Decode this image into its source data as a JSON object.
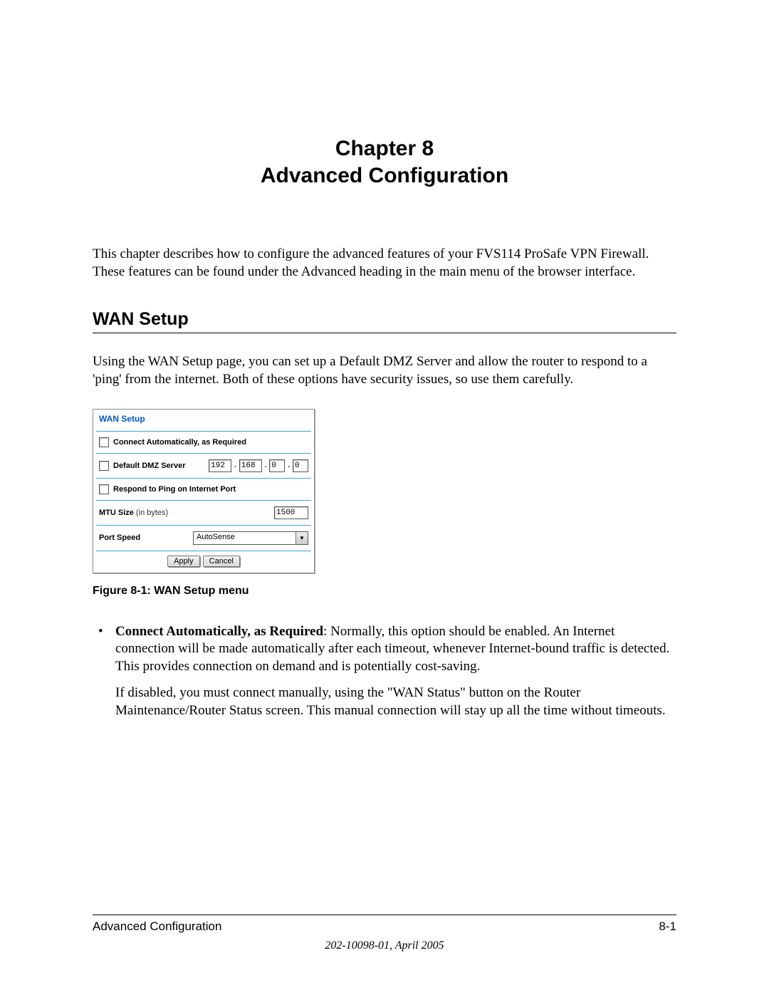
{
  "chapter": {
    "line1": "Chapter 8",
    "line2": "Advanced Configuration"
  },
  "intro": "This chapter describes how to configure the advanced features of your FVS114 ProSafe VPN Firewall. These features can be found under the Advanced heading in the main menu of the browser interface.",
  "section_heading": "WAN Setup",
  "section_para": "Using the WAN Setup page, you can set up a Default DMZ Server and allow the router to respond to a 'ping' from the internet. Both of these options have security issues, so use them carefully.",
  "wan_panel": {
    "title": "WAN Setup",
    "connect_auto_label": "Connect Automatically, as Required",
    "default_dmz_label": "Default DMZ Server",
    "ip": {
      "o1": "192",
      "o2": "168",
      "o3": "0",
      "o4": "0"
    },
    "respond_ping_label": "Respond to Ping on Internet Port",
    "mtu_label_bold": "MTU Size",
    "mtu_label_paren": " (in bytes)",
    "mtu_value": "1500",
    "port_speed_label": "Port Speed",
    "port_speed_value": "AutoSense",
    "apply_label": "Apply",
    "cancel_label": "Cancel"
  },
  "figure_caption": "Figure 8-1:  WAN Setup menu",
  "bullets": {
    "b1_title": "Connect Automatically, as Required",
    "b1_rest": ": Normally, this option should be enabled. An Internet connection will be made automatically after each timeout, whenever Internet-bound traffic is detected. This provides connection on demand and is potentially cost-saving.",
    "b1_p2": "If disabled, you must connect manually, using the \"WAN Status\" button on the Router Maintenance/Router Status screen. This manual connection will stay up all the time without timeouts."
  },
  "footer": {
    "left": "Advanced Configuration",
    "right": "8-1",
    "date": "202-10098-01, April 2005"
  }
}
